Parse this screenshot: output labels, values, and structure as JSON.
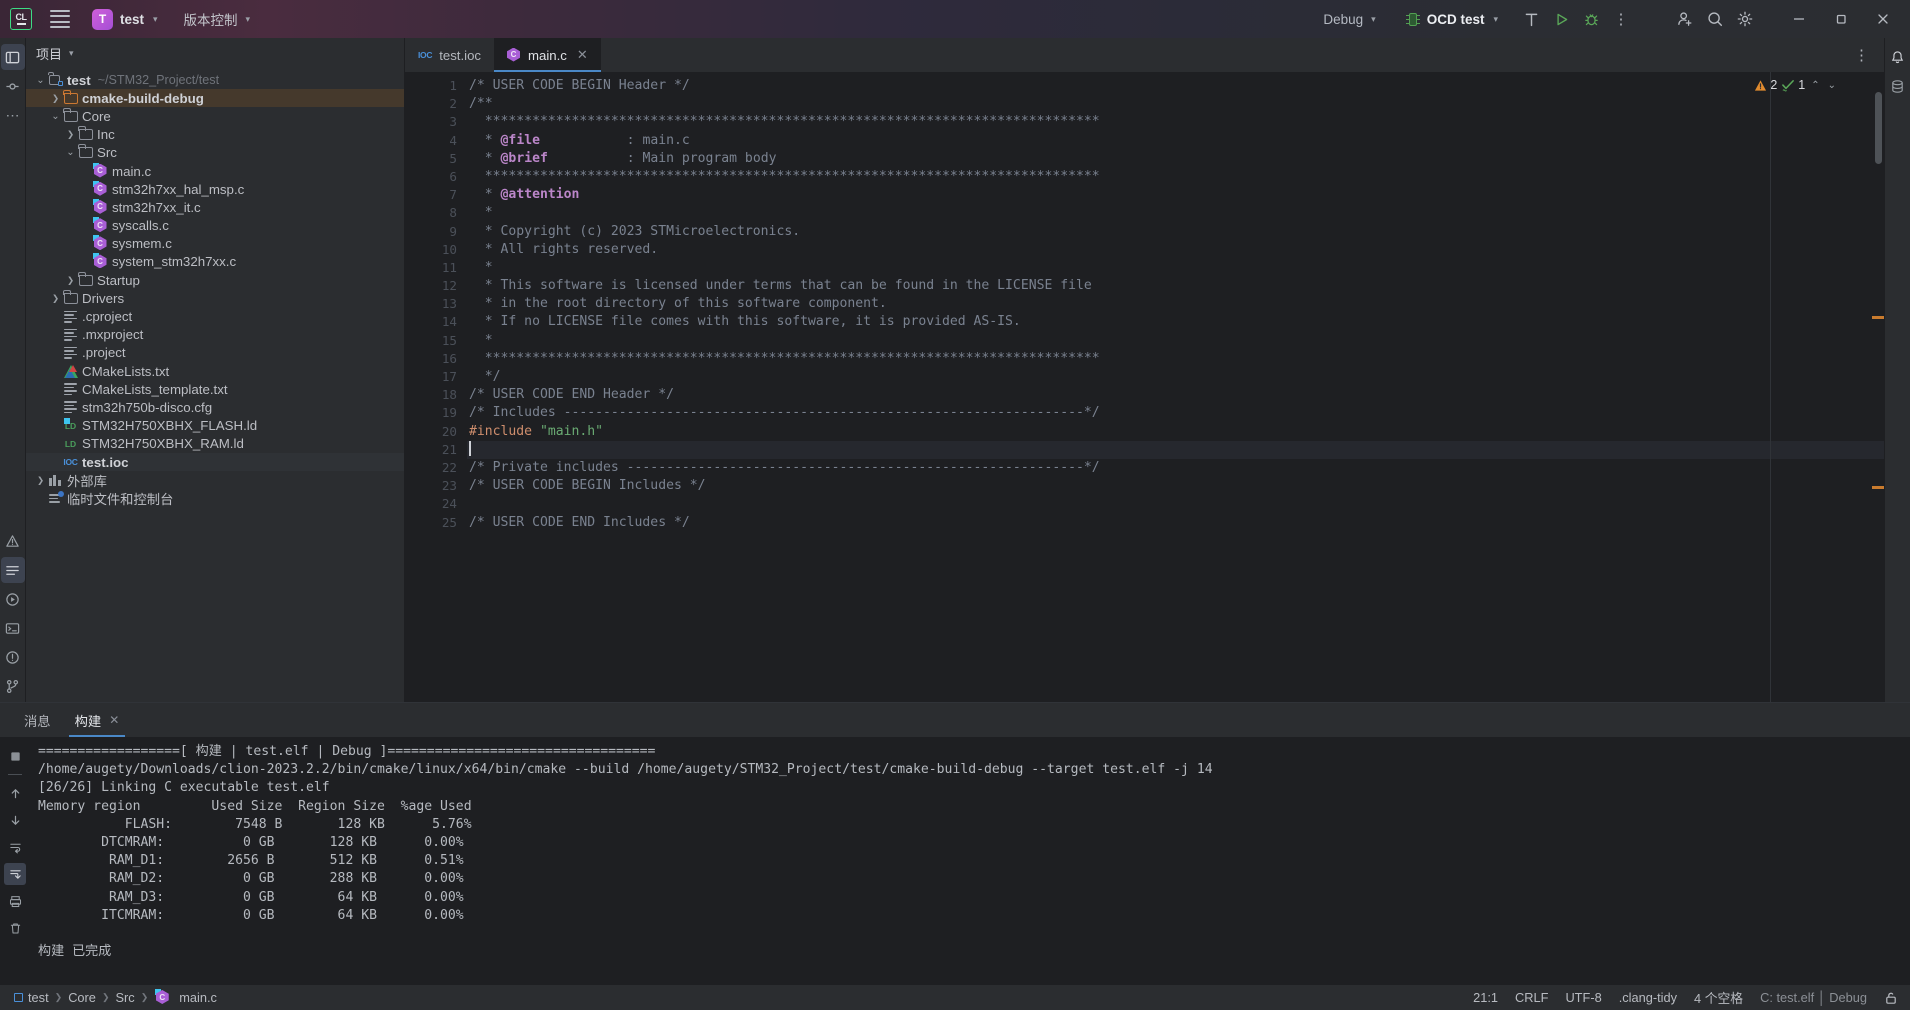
{
  "titlebar": {
    "logo": "CL",
    "project_name": "test",
    "vcs_label": "版本控制",
    "run_config_label": "Debug",
    "target_label": "OCD test",
    "icons": {
      "menu": "hamburger-icon",
      "build": "hammer-icon",
      "run": "run-icon",
      "debug": "debug-icon",
      "more": "more-vertical-icon",
      "account": "add-account-icon",
      "search": "search-icon",
      "settings": "gear-icon",
      "minimize": "minimize-icon",
      "maximize": "maximize-icon",
      "close": "close-icon"
    }
  },
  "sidebar": {
    "header_title": "项目",
    "tree": [
      {
        "indent": 0,
        "arrow": "down",
        "icon": "project-folder-icon",
        "label": "test",
        "path": "~/STM32_Project/test",
        "bold": true,
        "state": "none"
      },
      {
        "indent": 1,
        "arrow": "right",
        "icon": "folder-orange-icon",
        "label": "cmake-build-debug",
        "path": "",
        "bold": true,
        "state": "build-highlight"
      },
      {
        "indent": 1,
        "arrow": "down",
        "icon": "folder-icon",
        "label": "Core",
        "path": "",
        "bold": false,
        "state": "none"
      },
      {
        "indent": 2,
        "arrow": "right",
        "icon": "folder-icon",
        "label": "Inc",
        "path": "",
        "bold": false,
        "state": "none"
      },
      {
        "indent": 2,
        "arrow": "down",
        "icon": "folder-icon",
        "label": "Src",
        "path": "",
        "bold": false,
        "state": "none"
      },
      {
        "indent": 3,
        "arrow": "none",
        "icon": "c-file-icon",
        "label": "main.c",
        "path": "",
        "bold": false,
        "state": "none"
      },
      {
        "indent": 3,
        "arrow": "none",
        "icon": "c-file-icon",
        "label": "stm32h7xx_hal_msp.c",
        "path": "",
        "bold": false,
        "state": "none"
      },
      {
        "indent": 3,
        "arrow": "none",
        "icon": "c-file-icon",
        "label": "stm32h7xx_it.c",
        "path": "",
        "bold": false,
        "state": "none"
      },
      {
        "indent": 3,
        "arrow": "none",
        "icon": "c-file-icon",
        "label": "syscalls.c",
        "path": "",
        "bold": false,
        "state": "none"
      },
      {
        "indent": 3,
        "arrow": "none",
        "icon": "c-file-icon",
        "label": "sysmem.c",
        "path": "",
        "bold": false,
        "state": "none"
      },
      {
        "indent": 3,
        "arrow": "none",
        "icon": "c-file-icon",
        "label": "system_stm32h7xx.c",
        "path": "",
        "bold": false,
        "state": "none"
      },
      {
        "indent": 2,
        "arrow": "right",
        "icon": "folder-icon",
        "label": "Startup",
        "path": "",
        "bold": false,
        "state": "none"
      },
      {
        "indent": 1,
        "arrow": "right",
        "icon": "folder-icon",
        "label": "Drivers",
        "path": "",
        "bold": false,
        "state": "none"
      },
      {
        "indent": 1,
        "arrow": "none",
        "icon": "txt-file-icon",
        "label": ".cproject",
        "path": "",
        "bold": false,
        "state": "none"
      },
      {
        "indent": 1,
        "arrow": "none",
        "icon": "txt-file-icon",
        "label": ".mxproject",
        "path": "",
        "bold": false,
        "state": "none"
      },
      {
        "indent": 1,
        "arrow": "none",
        "icon": "txt-file-icon",
        "label": ".project",
        "path": "",
        "bold": false,
        "state": "none"
      },
      {
        "indent": 1,
        "arrow": "none",
        "icon": "cmake-file-icon",
        "label": "CMakeLists.txt",
        "path": "",
        "bold": false,
        "state": "none"
      },
      {
        "indent": 1,
        "arrow": "none",
        "icon": "txt-file-icon",
        "label": "CMakeLists_template.txt",
        "path": "",
        "bold": false,
        "state": "none"
      },
      {
        "indent": 1,
        "arrow": "none",
        "icon": "txt-file-icon",
        "label": "stm32h750b-disco.cfg",
        "path": "",
        "bold": false,
        "state": "none"
      },
      {
        "indent": 1,
        "arrow": "none",
        "icon": "ld-file-icon-badged",
        "label": "STM32H750XBHX_FLASH.ld",
        "path": "",
        "bold": false,
        "state": "none"
      },
      {
        "indent": 1,
        "arrow": "none",
        "icon": "ld-file-icon",
        "label": "STM32H750XBHX_RAM.ld",
        "path": "",
        "bold": false,
        "state": "none"
      },
      {
        "indent": 1,
        "arrow": "none",
        "icon": "ioc-file-icon",
        "label": "test.ioc",
        "path": "",
        "bold": true,
        "state": "selected"
      },
      {
        "indent": 0,
        "arrow": "right",
        "icon": "library-icon",
        "label": "外部库",
        "path": "",
        "bold": false,
        "state": "none"
      },
      {
        "indent": 0,
        "arrow": "none",
        "icon": "scratch-icon",
        "label": "临时文件和控制台",
        "path": "",
        "bold": false,
        "state": "none"
      }
    ]
  },
  "editor": {
    "tabs": [
      {
        "label": "test.ioc",
        "icon": "ioc-file-icon",
        "active": false,
        "closable": false
      },
      {
        "label": "main.c",
        "icon": "c-file-icon",
        "active": true,
        "closable": true
      }
    ],
    "inspections": {
      "warning_count": "2",
      "ok_count": "1"
    },
    "lines": [
      {
        "n": "1",
        "segs": [
          {
            "t": "/* USER CODE BEGIN Header */",
            "c": "cm"
          }
        ]
      },
      {
        "n": "2",
        "segs": [
          {
            "t": "/**",
            "c": "cm"
          }
        ]
      },
      {
        "n": "3",
        "segs": [
          {
            "t": "  ******************************************************************************",
            "c": "cm"
          }
        ]
      },
      {
        "n": "4",
        "segs": [
          {
            "t": "  * ",
            "c": "cm"
          },
          {
            "t": "@file",
            "c": "tag"
          },
          {
            "t": "           : main.c",
            "c": "cm"
          }
        ]
      },
      {
        "n": "5",
        "segs": [
          {
            "t": "  * ",
            "c": "cm"
          },
          {
            "t": "@brief",
            "c": "tag"
          },
          {
            "t": "          : Main program body",
            "c": "cm"
          }
        ]
      },
      {
        "n": "6",
        "segs": [
          {
            "t": "  ******************************************************************************",
            "c": "cm"
          }
        ]
      },
      {
        "n": "7",
        "segs": [
          {
            "t": "  * ",
            "c": "cm"
          },
          {
            "t": "@attention",
            "c": "tag"
          }
        ]
      },
      {
        "n": "8",
        "segs": [
          {
            "t": "  *",
            "c": "cm"
          }
        ]
      },
      {
        "n": "9",
        "segs": [
          {
            "t": "  * Copyright (c) 2023 STMicroelectronics.",
            "c": "cm"
          }
        ]
      },
      {
        "n": "10",
        "segs": [
          {
            "t": "  * All rights reserved.",
            "c": "cm"
          }
        ]
      },
      {
        "n": "11",
        "segs": [
          {
            "t": "  *",
            "c": "cm"
          }
        ]
      },
      {
        "n": "12",
        "segs": [
          {
            "t": "  * This software is licensed under terms that can be found in the LICENSE file",
            "c": "cm"
          }
        ]
      },
      {
        "n": "13",
        "segs": [
          {
            "t": "  * in the root directory of this software component.",
            "c": "cm"
          }
        ]
      },
      {
        "n": "14",
        "segs": [
          {
            "t": "  * If no LICENSE file comes with this software, it is provided AS-IS.",
            "c": "cm"
          }
        ]
      },
      {
        "n": "15",
        "segs": [
          {
            "t": "  *",
            "c": "cm"
          }
        ]
      },
      {
        "n": "16",
        "segs": [
          {
            "t": "  ******************************************************************************",
            "c": "cm"
          }
        ]
      },
      {
        "n": "17",
        "segs": [
          {
            "t": "  */",
            "c": "cm"
          }
        ]
      },
      {
        "n": "18",
        "segs": [
          {
            "t": "/* USER CODE END Header */",
            "c": "cm"
          }
        ]
      },
      {
        "n": "19",
        "segs": [
          {
            "t": "/* Includes ------------------------------------------------------------------*/",
            "c": "cm"
          }
        ]
      },
      {
        "n": "20",
        "segs": [
          {
            "t": "#include",
            "c": "kw"
          },
          {
            "t": " ",
            "c": "cm"
          },
          {
            "t": "\"main.h\"",
            "c": "str"
          }
        ]
      },
      {
        "n": "21",
        "segs": [],
        "current": true
      },
      {
        "n": "22",
        "segs": [
          {
            "t": "/* Private includes ----------------------------------------------------------*/",
            "c": "cm"
          }
        ]
      },
      {
        "n": "23",
        "segs": [
          {
            "t": "/* USER CODE BEGIN Includes */",
            "c": "cm"
          }
        ]
      },
      {
        "n": "24",
        "segs": []
      },
      {
        "n": "25",
        "segs": [
          {
            "t": "/* USER CODE END Includes */",
            "c": "cm"
          }
        ]
      }
    ]
  },
  "bottom_panel": {
    "tabs": [
      {
        "label": "消息",
        "active": false,
        "closable": false
      },
      {
        "label": "构建",
        "active": true,
        "closable": true
      }
    ],
    "console_lines": [
      "==================[ 构建 | test.elf | Debug ]==================================",
      "/home/augety/Downloads/clion-2023.2.2/bin/cmake/linux/x64/bin/cmake --build /home/augety/STM32_Project/test/cmake-build-debug --target test.elf -j 14",
      "[26/26] Linking C executable test.elf",
      "Memory region         Used Size  Region Size  %age Used",
      "           FLASH:        7548 B       128 KB      5.76%",
      "        DTCMRAM:          0 GB       128 KB      0.00%",
      "         RAM_D1:        2656 B       512 KB      0.51%",
      "         RAM_D2:          0 GB       288 KB      0.00%",
      "         RAM_D3:          0 GB        64 KB      0.00%",
      "        ITCMRAM:          0 GB        64 KB      0.00%",
      "",
      "构建 已完成"
    ]
  },
  "status_bar": {
    "breadcrumbs": [
      "test",
      "Core",
      "Src",
      "main.c"
    ],
    "caret_position": "21:1",
    "line_separator": "CRLF",
    "encoding": "UTF-8",
    "inspection_profile": ".clang-tidy",
    "indent": "4 个空格",
    "build_target": "C: test.elf",
    "build_config": "Debug"
  },
  "colors": {
    "accent_blue": "#4a88c7",
    "warning_orange": "#e08a2e",
    "ok_green": "#5aa758",
    "build_highlight": "#45392c",
    "panel_bg": "#2b2d30",
    "editor_bg": "#1e1f22"
  }
}
